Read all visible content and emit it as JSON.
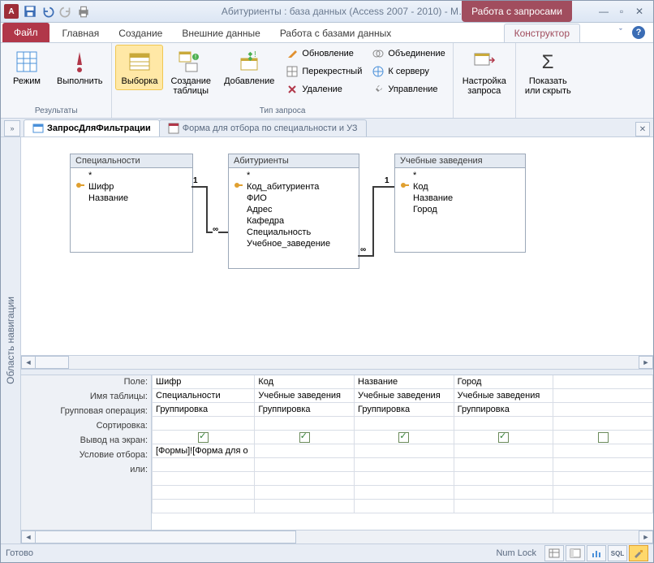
{
  "titlebar": {
    "app_letter": "A",
    "title": "Абитуриенты : база данных (Access 2007 - 2010) - M…",
    "context_tab": "Работа с запросами"
  },
  "ribbon_tabs": {
    "file": "Файл",
    "home": "Главная",
    "create": "Создание",
    "external": "Внешние данные",
    "dbtools": "Работа с базами данных",
    "designer": "Конструктор"
  },
  "ribbon": {
    "results": {
      "label": "Результаты",
      "mode": "Режим",
      "run": "Выполнить"
    },
    "qtype": {
      "label": "Тип запроса",
      "select": "Выборка",
      "make_table": "Создание\nтаблицы",
      "append": "Добавление",
      "update": "Обновление",
      "crosstab": "Перекрестный",
      "delete": "Удаление",
      "union": "Объединение",
      "passthrough": "К серверу",
      "datadef": "Управление"
    },
    "setup": {
      "label": "Настройка\nзапроса"
    },
    "showhide": {
      "label": "Показать\nили скрыть"
    }
  },
  "doc_tabs": {
    "active": "ЗапросДляФильтрации",
    "inactive": "Форма для отбора по специальности и УЗ"
  },
  "navpane": "Область навигации",
  "tables": {
    "spec": {
      "title": "Специальности",
      "star": "*",
      "fields": [
        "Шифр",
        "Название"
      ]
    },
    "abit": {
      "title": "Абитуриенты",
      "star": "*",
      "fields": [
        "Код_абитуриента",
        "ФИО",
        "Адрес",
        "Кафедра",
        "Специальность",
        "Учебное_заведение"
      ]
    },
    "uz": {
      "title": "Учебные заведения",
      "star": "*",
      "fields": [
        "Код",
        "Название",
        "Город"
      ]
    }
  },
  "rel": {
    "one": "1",
    "many": "∞"
  },
  "grid": {
    "labels": {
      "field": "Поле:",
      "table": "Имя таблицы:",
      "total": "Групповая операция:",
      "sort": "Сортировка:",
      "show": "Вывод на экран:",
      "criteria": "Условие отбора:",
      "or": "или:"
    },
    "cols": [
      {
        "field": "Шифр",
        "table": "Специальности",
        "total": "Группировка",
        "show": true,
        "criteria": "[Формы]![Форма для о"
      },
      {
        "field": "Код",
        "table": "Учебные заведения",
        "total": "Группировка",
        "show": true,
        "criteria": ""
      },
      {
        "field": "Название",
        "table": "Учебные заведения",
        "total": "Группировка",
        "show": true,
        "criteria": ""
      },
      {
        "field": "Город",
        "table": "Учебные заведения",
        "total": "Группировка",
        "show": true,
        "criteria": ""
      },
      {
        "field": "",
        "table": "",
        "total": "",
        "show": false,
        "criteria": ""
      }
    ]
  },
  "status": {
    "ready": "Готово",
    "numlock": "Num Lock",
    "sql": "SQL"
  }
}
